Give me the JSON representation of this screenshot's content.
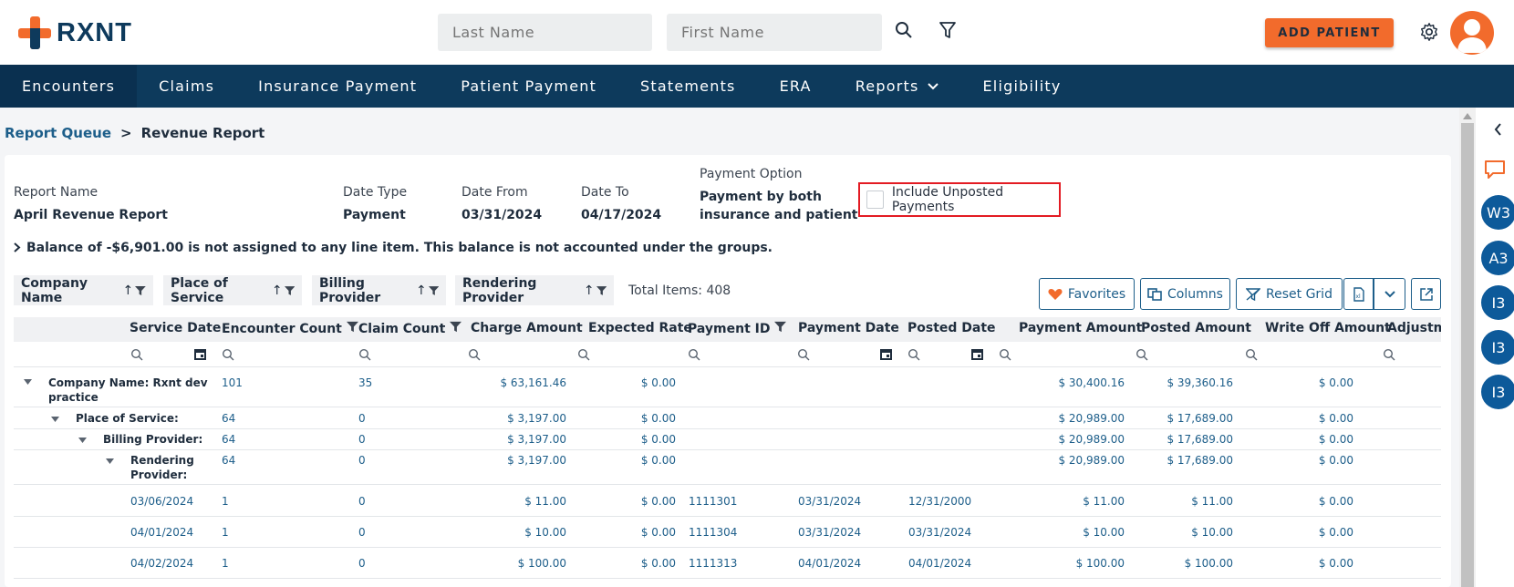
{
  "header": {
    "logo_text": "RXNT",
    "last_name_placeholder": "Last Name",
    "first_name_placeholder": "First Name",
    "add_patient_label": "ADD PATIENT"
  },
  "nav": {
    "items": [
      "Encounters",
      "Claims",
      "Insurance Payment",
      "Patient Payment",
      "Statements",
      "ERA",
      "Reports",
      "Eligibility"
    ]
  },
  "breadcrumb": {
    "parent": "Report Queue",
    "separator": ">",
    "current": "Revenue Report"
  },
  "report": {
    "report_name_label": "Report Name",
    "report_name": "April Revenue Report",
    "date_type_label": "Date Type",
    "date_type": "Payment",
    "date_from_label": "Date From",
    "date_from": "03/31/2024",
    "date_to_label": "Date To",
    "date_to": "04/17/2024",
    "payment_option_label": "Payment Option",
    "payment_option_line1": "Payment by both",
    "payment_option_line2": "insurance and patient",
    "include_unposted_label": "Include Unposted Payments",
    "include_unposted_checked": false,
    "balance_note": "Balance of -$6,901.00 is not assigned to any line item. This balance is not accounted under the groups."
  },
  "grouping": {
    "chips": [
      "Company Name",
      "Place of Service",
      "Billing Provider",
      "Rendering Provider"
    ],
    "total_items": "Total Items: 408"
  },
  "toolbar": {
    "favorites": "Favorites",
    "columns": "Columns",
    "reset_grid": "Reset Grid"
  },
  "grid": {
    "columns": [
      "Service Date",
      "Encounter Count",
      "Claim Count",
      "Charge Amount",
      "Expected Rate",
      "Payment ID",
      "Payment Date",
      "Posted Date",
      "Payment Amount",
      "Posted Amount",
      "Write Off Amount",
      "Adjustme"
    ],
    "groups": [
      {
        "label1": "Company Name: Rxnt dev",
        "label2": "practice",
        "encounter": "101",
        "claim": "35",
        "charge": "$ 63,161.46",
        "expected": "$ 0.00",
        "payment_amount": "$ 30,400.16",
        "posted_amount": "$ 39,360.16",
        "write_off": "$ 0.00"
      },
      {
        "label1": "Place of Service:",
        "label2": "",
        "encounter": "64",
        "claim": "0",
        "charge": "$ 3,197.00",
        "expected": "$ 0.00",
        "payment_amount": "$ 20,989.00",
        "posted_amount": "$ 17,689.00",
        "write_off": "$ 0.00"
      },
      {
        "label1": "Billing Provider:",
        "label2": "",
        "encounter": "64",
        "claim": "0",
        "charge": "$ 3,197.00",
        "expected": "$ 0.00",
        "payment_amount": "$ 20,989.00",
        "posted_amount": "$ 17,689.00",
        "write_off": "$ 0.00"
      },
      {
        "label1": "Rendering",
        "label2": "Provider:",
        "encounter": "64",
        "claim": "0",
        "charge": "$ 3,197.00",
        "expected": "$ 0.00",
        "payment_amount": "$ 20,989.00",
        "posted_amount": "$ 17,689.00",
        "write_off": "$ 0.00"
      }
    ],
    "rows": [
      {
        "service_date": "03/06/2024",
        "encounter": "1",
        "claim": "0",
        "charge": "$ 11.00",
        "expected": "$ 0.00",
        "payment_id": "1111301",
        "payment_date": "03/31/2024",
        "posted_date": "12/31/2000",
        "payment_amount": "$ 11.00",
        "posted_amount": "$ 11.00",
        "write_off": "$ 0.00"
      },
      {
        "service_date": "04/01/2024",
        "encounter": "1",
        "claim": "0",
        "charge": "$ 10.00",
        "expected": "$ 0.00",
        "payment_id": "1111304",
        "payment_date": "03/31/2024",
        "posted_date": "03/31/2024",
        "payment_amount": "$ 10.00",
        "posted_amount": "$ 10.00",
        "write_off": "$ 0.00"
      },
      {
        "service_date": "04/02/2024",
        "encounter": "1",
        "claim": "0",
        "charge": "$ 100.00",
        "expected": "$ 0.00",
        "payment_id": "1111313",
        "payment_date": "04/01/2024",
        "posted_date": "04/01/2024",
        "payment_amount": "$ 100.00",
        "posted_amount": "$ 100.00",
        "write_off": "$ 0.00"
      }
    ]
  },
  "right_rail": {
    "bubbles": [
      "W3",
      "A3",
      "I3",
      "I3",
      "I3"
    ]
  },
  "colors": {
    "brand_orange": "#f26b2c",
    "nav_blue": "#0d3a5c",
    "link_blue": "#1d5e8a",
    "highlight_red": "#e31b23"
  }
}
